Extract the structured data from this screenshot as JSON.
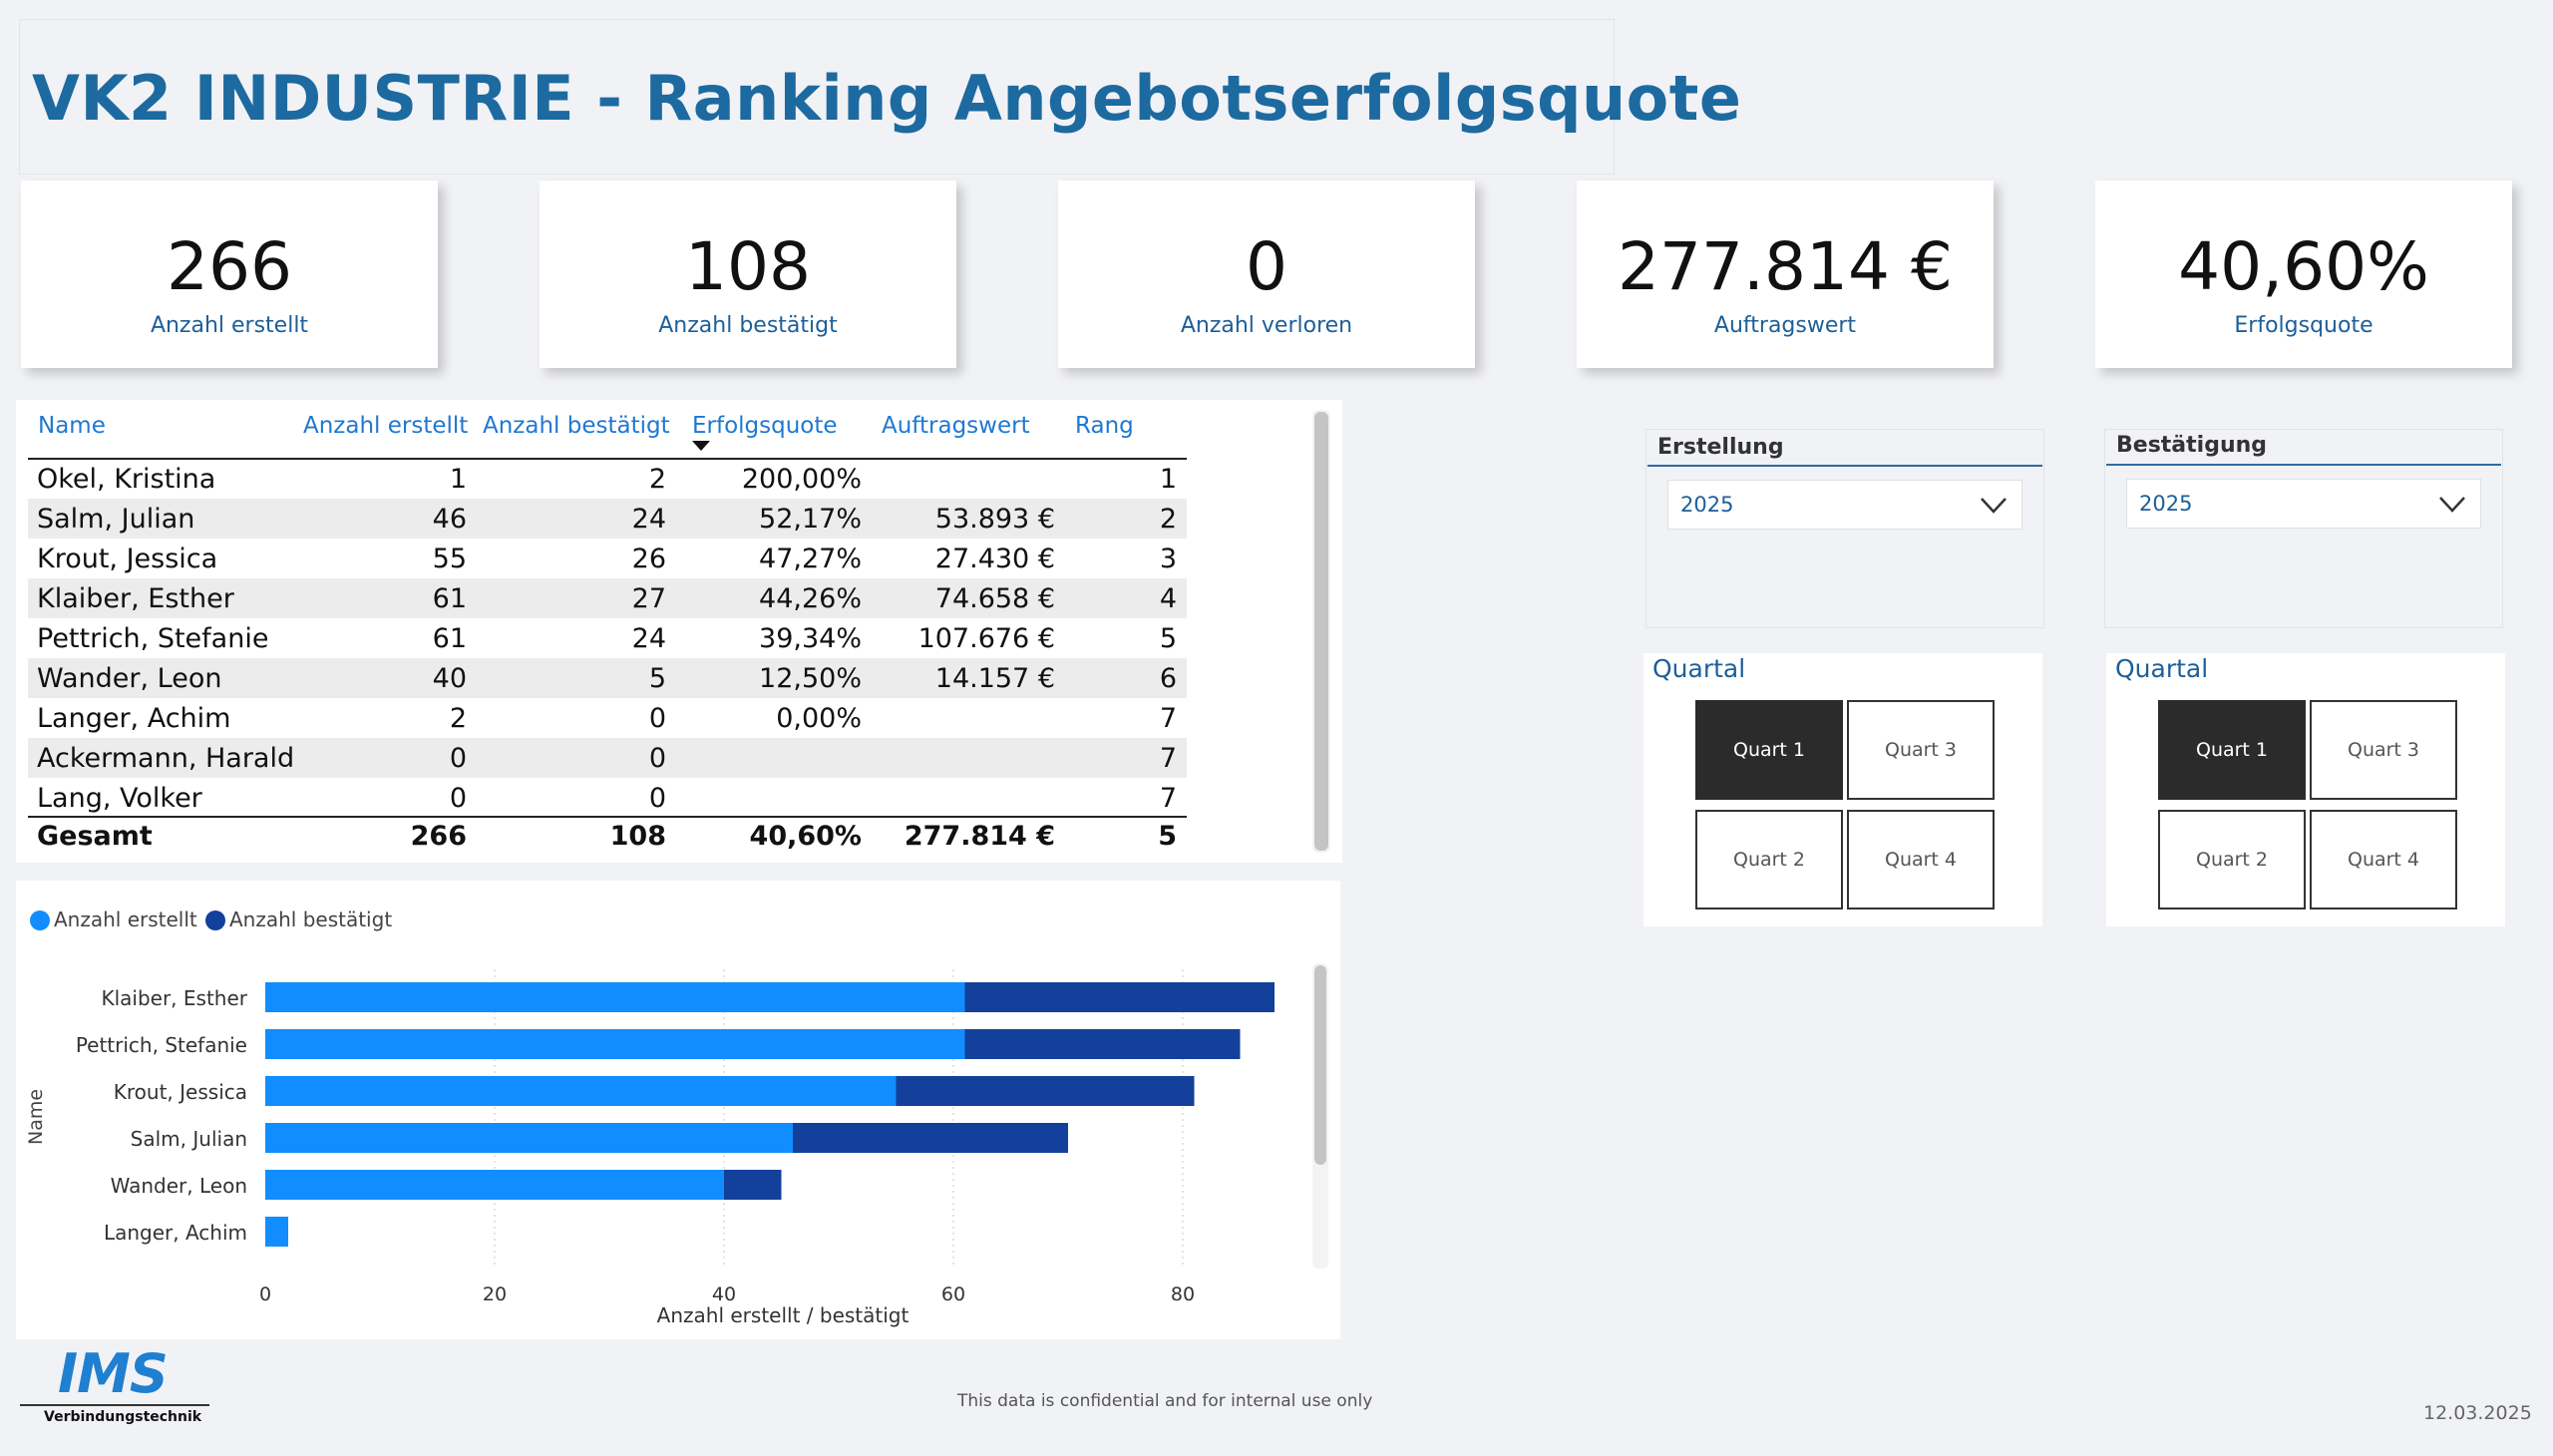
{
  "title": "VK2 INDUSTRIE - Ranking Angebotserfolgsquote",
  "kpis": [
    {
      "value": "266",
      "label": "Anzahl erstellt"
    },
    {
      "value": "108",
      "label": "Anzahl bestätigt"
    },
    {
      "value": "0",
      "label": "Anzahl verloren"
    },
    {
      "value": "277.814 €",
      "label": "Auftragswert"
    },
    {
      "value": "40,60%",
      "label": "Erfolgsquote"
    }
  ],
  "table": {
    "headers": [
      "Name",
      "Anzahl erstellt",
      "Anzahl bestätigt",
      "Erfolgsquote",
      "Auftragswert",
      "Rang"
    ],
    "sort_column": "Erfolgsquote",
    "rows": [
      [
        "Okel, Kristina",
        "1",
        "2",
        "200,00%",
        "",
        "1"
      ],
      [
        "Salm, Julian",
        "46",
        "24",
        "52,17%",
        "53.893 €",
        "2"
      ],
      [
        "Krout, Jessica",
        "55",
        "26",
        "47,27%",
        "27.430 €",
        "3"
      ],
      [
        "Klaiber, Esther",
        "61",
        "27",
        "44,26%",
        "74.658 €",
        "4"
      ],
      [
        "Pettrich, Stefanie",
        "61",
        "24",
        "39,34%",
        "107.676 €",
        "5"
      ],
      [
        "Wander, Leon",
        "40",
        "5",
        "12,50%",
        "14.157 €",
        "6"
      ],
      [
        "Langer, Achim",
        "2",
        "0",
        "0,00%",
        "",
        "7"
      ],
      [
        "Ackermann, Harald",
        "0",
        "0",
        "",
        "",
        "7"
      ],
      [
        "Lang, Volker",
        "0",
        "0",
        "",
        "",
        "7"
      ]
    ],
    "total": [
      "Gesamt",
      "266",
      "108",
      "40,60%",
      "277.814 €",
      "5"
    ]
  },
  "chart_data": {
    "type": "bar",
    "orientation": "horizontal",
    "stacked": true,
    "categories": [
      "Klaiber, Esther",
      "Pettrich, Stefanie",
      "Krout, Jessica",
      "Salm, Julian",
      "Wander, Leon",
      "Langer, Achim"
    ],
    "series": [
      {
        "name": "Anzahl erstellt",
        "values": [
          61,
          61,
          55,
          46,
          40,
          2
        ],
        "color": "#118dff"
      },
      {
        "name": "Anzahl bestätigt",
        "values": [
          27,
          24,
          26,
          24,
          5,
          0
        ],
        "color": "#12409a"
      }
    ],
    "xlabel": "Anzahl erstellt / bestätigt",
    "ylabel": "Name",
    "xticks": [
      0,
      20,
      40,
      60,
      80
    ],
    "xlim": [
      0,
      90
    ],
    "legend": "top-left",
    "grid": true
  },
  "slicers": {
    "erstellung": {
      "title": "Erstellung",
      "value": "2025"
    },
    "bestaetigung": {
      "title": "Bestätigung",
      "value": "2025"
    },
    "quartal_left": {
      "title": "Quartal",
      "buttons": [
        "Quart 1",
        "Quart 3",
        "Quart 2",
        "Quart 4"
      ],
      "selected": "Quart 1"
    },
    "quartal_right": {
      "title": "Quartal",
      "buttons": [
        "Quart 1",
        "Quart 3",
        "Quart 2",
        "Quart 4"
      ],
      "selected": "Quart 1"
    }
  },
  "footer": {
    "logo": "IMS",
    "logo_sub": "Verbindungstechnik",
    "confidential": "This data is confidential and for internal use only",
    "date": "12.03.2025"
  },
  "colors": {
    "accent": "#1d6aa0",
    "series1": "#118dff",
    "series2": "#12409a",
    "selected_button": "#2b2b2b"
  }
}
